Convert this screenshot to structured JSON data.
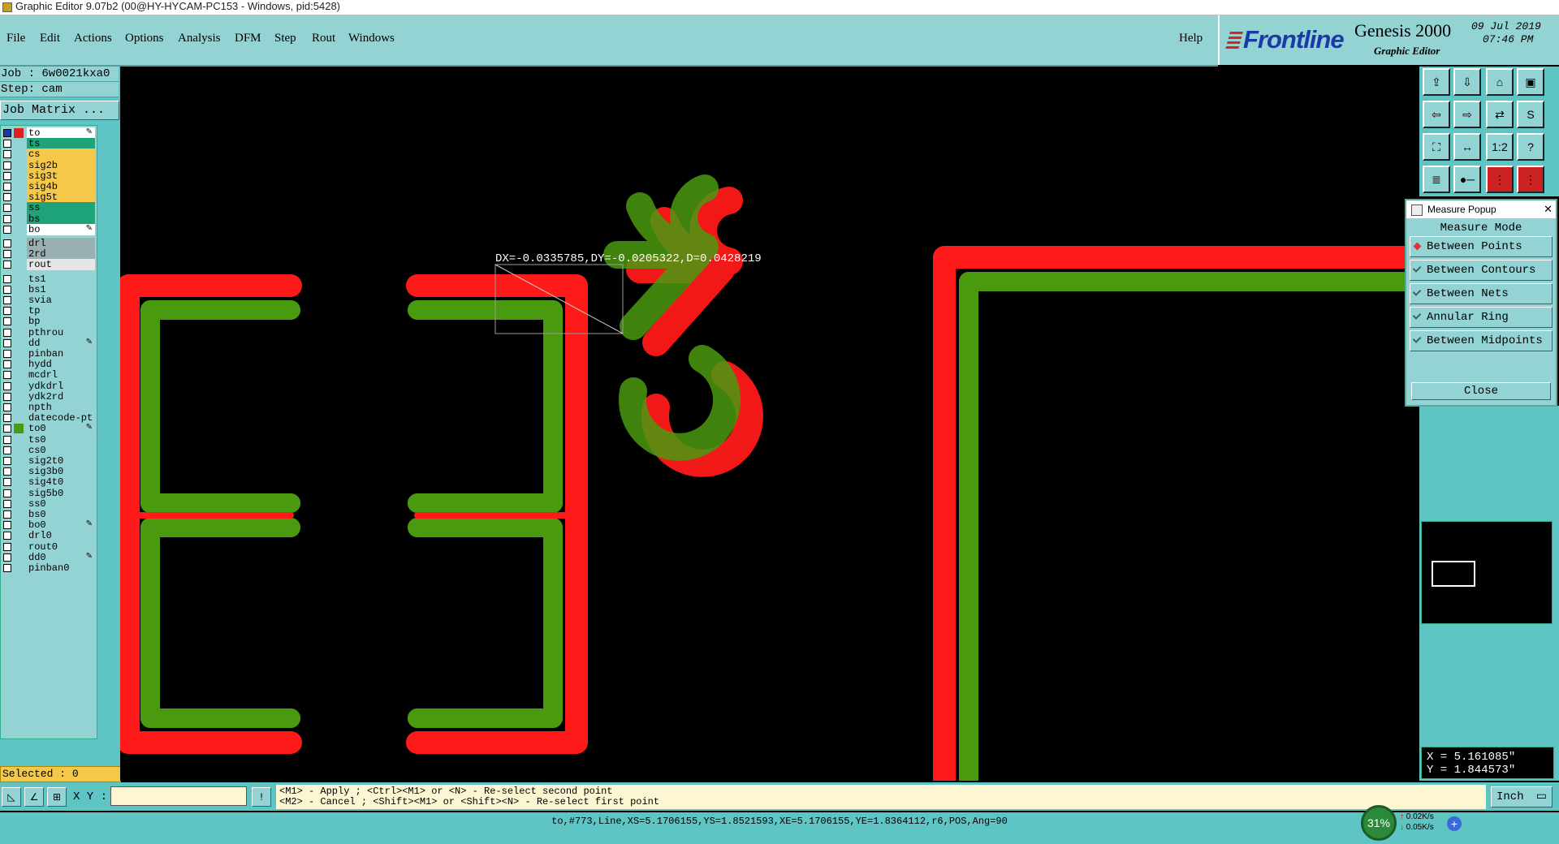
{
  "window": {
    "title": "Graphic Editor 9.07b2 (00@HY-HYCAM-PC153 - Windows, pid:5428)"
  },
  "menu": [
    {
      "label": "File"
    },
    {
      "label": "Edit"
    },
    {
      "label": "Actions"
    },
    {
      "label": "Options"
    },
    {
      "label": "Analysis"
    },
    {
      "label": "DFM"
    },
    {
      "label": "Step"
    },
    {
      "label": "Rout"
    },
    {
      "label": "Windows"
    }
  ],
  "help_label": "Help",
  "brand": {
    "logo": "Frontline",
    "product": "Genesis 2000",
    "subtitle": "Graphic Editor",
    "date": "09 Jul 2019",
    "time": "07:46 PM"
  },
  "job": {
    "job_line": "Job : 6w0021kxa0",
    "step_line": "Step: cam",
    "matrix_button": "Job Matrix ..."
  },
  "layers": [
    {
      "name": "to",
      "color": "#ffffff",
      "swatch": "#e02020",
      "active": true,
      "icon": "pencil"
    },
    {
      "name": "ts",
      "color": "#1fa37a"
    },
    {
      "name": "cs",
      "color": "#f5c84a"
    },
    {
      "name": "sig2b",
      "color": "#f5c84a"
    },
    {
      "name": "sig3t",
      "color": "#f5c84a"
    },
    {
      "name": "sig4b",
      "color": "#f5c84a"
    },
    {
      "name": "sig5t",
      "color": "#f5c84a"
    },
    {
      "name": "ss",
      "color": "#1fa37a"
    },
    {
      "name": "bs",
      "color": "#1fa37a"
    },
    {
      "name": "bo",
      "color": "#ffffff",
      "icon": "pencil"
    },
    {
      "name": "drl",
      "color": "#9ab0b0",
      "gap": true
    },
    {
      "name": "2rd",
      "color": "#9ab0b0"
    },
    {
      "name": "rout",
      "color": "#e6e6e6"
    },
    {
      "name": "ts1",
      "color": "#94d3d3",
      "gap": true
    },
    {
      "name": "bs1",
      "color": "#94d3d3"
    },
    {
      "name": "svia",
      "color": "#94d3d3"
    },
    {
      "name": "tp",
      "color": "#94d3d3"
    },
    {
      "name": "bp",
      "color": "#94d3d3"
    },
    {
      "name": "pthrou",
      "color": "#94d3d3"
    },
    {
      "name": "dd",
      "color": "#94d3d3",
      "icon": "pencil"
    },
    {
      "name": "pinban",
      "color": "#94d3d3"
    },
    {
      "name": "hydd",
      "color": "#94d3d3"
    },
    {
      "name": "mcdrl",
      "color": "#94d3d3"
    },
    {
      "name": "ydkdrl",
      "color": "#94d3d3"
    },
    {
      "name": "ydk2rd",
      "color": "#94d3d3"
    },
    {
      "name": "npth",
      "color": "#94d3d3"
    },
    {
      "name": "datecode-pt",
      "color": "#94d3d3"
    },
    {
      "name": "to0",
      "color": "#94d3d3",
      "swatch": "#4a9a10",
      "icon": "pencil"
    },
    {
      "name": "ts0",
      "color": "#94d3d3"
    },
    {
      "name": "cs0",
      "color": "#94d3d3"
    },
    {
      "name": "sig2t0",
      "color": "#94d3d3"
    },
    {
      "name": "sig3b0",
      "color": "#94d3d3"
    },
    {
      "name": "sig4t0",
      "color": "#94d3d3"
    },
    {
      "name": "sig5b0",
      "color": "#94d3d3"
    },
    {
      "name": "ss0",
      "color": "#94d3d3"
    },
    {
      "name": "bs0",
      "color": "#94d3d3"
    },
    {
      "name": "bo0",
      "color": "#94d3d3",
      "icon": "pencil"
    },
    {
      "name": "drl0",
      "color": "#94d3d3"
    },
    {
      "name": "rout0",
      "color": "#94d3d3"
    },
    {
      "name": "dd0",
      "color": "#94d3d3",
      "icon": "pencil"
    },
    {
      "name": "pinban0",
      "color": "#94d3d3"
    }
  ],
  "selected_label": "Selected : 0",
  "measurement": {
    "readout": "DX=-0.0335785,DY=-0.0205322,D=0.0428219"
  },
  "measure_popup": {
    "title": "Measure Popup",
    "mode_label": "Measure Mode",
    "options": [
      {
        "label": "Between Points",
        "selected": true
      },
      {
        "label": "Between Contours",
        "selected": false
      },
      {
        "label": "Between Nets",
        "selected": false
      },
      {
        "label": "Annular Ring",
        "selected": false
      },
      {
        "label": "Between Midpoints",
        "selected": false
      }
    ],
    "close_label": "Close"
  },
  "coords": {
    "x": "X = 5.161085\"",
    "y": "Y = 1.844573\""
  },
  "bottom": {
    "xy_label": "X Y :",
    "xy_value": "",
    "prompt_line1": "<M1> - Apply  ; <Ctrl><M1> or <N> - Re-select second point",
    "prompt_line2": "<M2> - Cancel ; <Shift><M1> or <Shift><N> - Re-select first point",
    "unit": "Inch"
  },
  "status": "to,#773,Line,XS=5.1706155,YS=1.8521593,XE=5.1706155,YE=1.8364112,r6,POS,Ang=90",
  "system": {
    "cpu": "31%",
    "up": "0.02K/s",
    "down": "0.05K/s"
  },
  "colors": {
    "panel": "#94d3d3",
    "panel_dark": "#5ec4c4",
    "layer_to": "#ff1a1a",
    "layer_to0": "#4a9a10",
    "overlap": "#b8a020"
  }
}
